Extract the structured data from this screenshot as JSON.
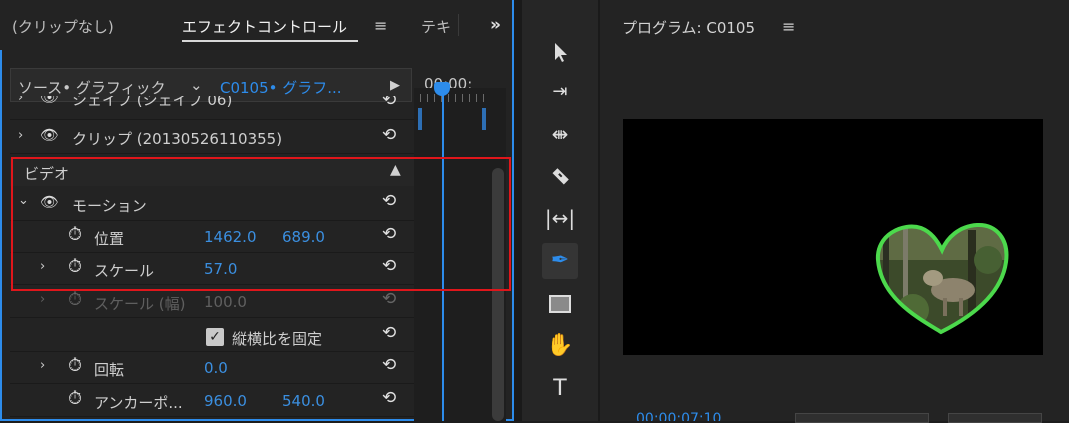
{
  "effect_controls": {
    "tab_no_clip": "(クリップなし)",
    "tab_effect_controls": "エフェクトコントロール",
    "tab_menu_symbol": "≡",
    "tab_text": "テキ",
    "overflow_symbol": "»",
    "source_label": "ソース• グラフィック",
    "clip_label": "C0105• グラフ...",
    "timecode": "00;00;",
    "rows": {
      "shape": {
        "label": "シェイプ (シェイプ 06)"
      },
      "clip": {
        "label": "クリップ (20130526110355)"
      },
      "video_section": {
        "label": "ビデオ"
      },
      "motion": {
        "label": "モーション"
      },
      "position": {
        "label": "位置",
        "x": "1462.0",
        "y": "689.0"
      },
      "scale": {
        "label": "スケール",
        "value": "57.0"
      },
      "scale_width": {
        "label": "スケール (幅)",
        "value": "100.0"
      },
      "uniform_scale": {
        "label": "縦横比を固定",
        "checked": true
      },
      "rotation": {
        "label": "回転",
        "value": "0.0"
      },
      "anchor": {
        "label": "アンカーポ...",
        "x": "960.0",
        "y": "540.0"
      }
    }
  },
  "program": {
    "title": "プログラム: C0105",
    "menu_symbol": "≡",
    "timecode_partial": "00;00;07;10"
  },
  "icons": {
    "eye": "eye-icon",
    "stopwatch": "stopwatch-icon",
    "reset": "reset-icon",
    "selection": "selection-tool-icon",
    "track_select": "track-select-tool-icon",
    "ripple": "ripple-edit-tool-icon",
    "razor": "razor-tool-icon",
    "slip": "slip-tool-icon",
    "pen": "pen-tool-icon",
    "rectangle": "rectangle-tool-icon",
    "hand": "hand-tool-icon",
    "type": "type-tool-icon"
  },
  "colors": {
    "accent": "#2d8ceb",
    "highlight": "#e0161b",
    "heart_outline": "#4cd94c"
  }
}
